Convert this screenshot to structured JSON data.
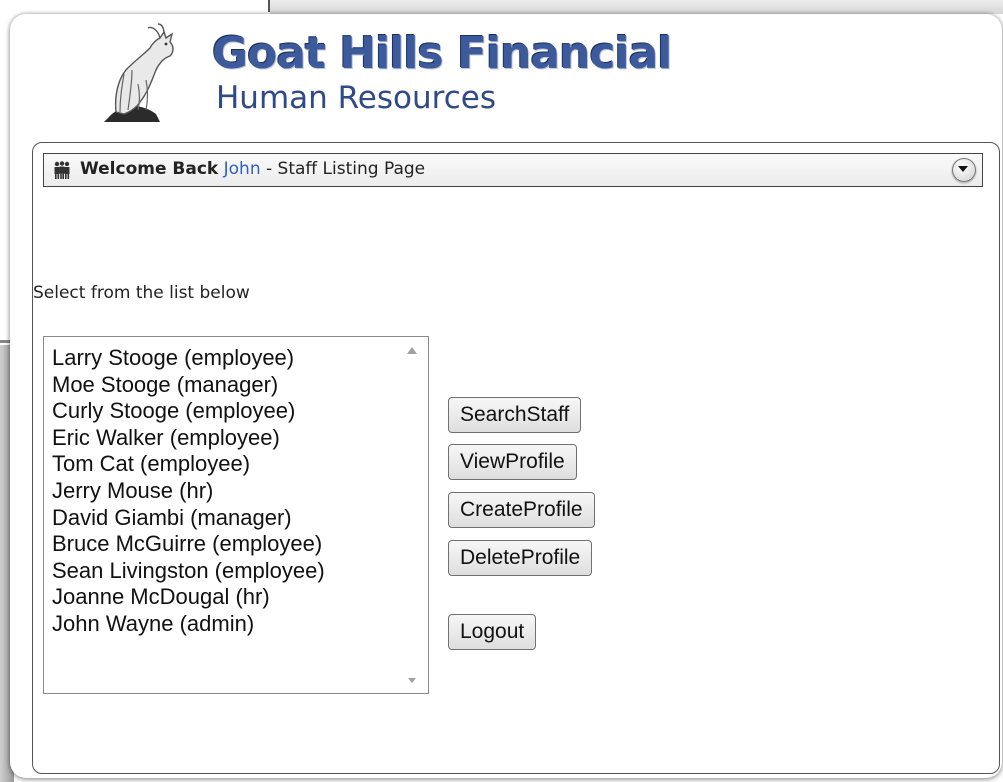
{
  "brand": {
    "title": "Goat Hills Financial",
    "subtitle": "Human Resources"
  },
  "header": {
    "welcome": "Welcome Back",
    "user": "John",
    "page": " - Staff Listing Page"
  },
  "instructions": "Select from the list below",
  "staff_list": [
    "Larry Stooge (employee)",
    "Moe Stooge (manager)",
    "Curly Stooge (employee)",
    "Eric Walker (employee)",
    "Tom Cat (employee)",
    "Jerry Mouse (hr)",
    "David Giambi (manager)",
    "Bruce McGuirre (employee)",
    "Sean Livingston (employee)",
    "Joanne McDougal (hr)",
    "John Wayne (admin)"
  ],
  "buttons": {
    "search": "SearchStaff",
    "view": "ViewProfile",
    "create": "CreateProfile",
    "delete": "DeleteProfile",
    "logout": "Logout"
  },
  "icons": {
    "logo": "goat-icon",
    "header": "people-icon",
    "collapse": "chevron-down-icon"
  },
  "colors": {
    "brand": "#3d5a9a",
    "user_link": "#3060c0"
  }
}
